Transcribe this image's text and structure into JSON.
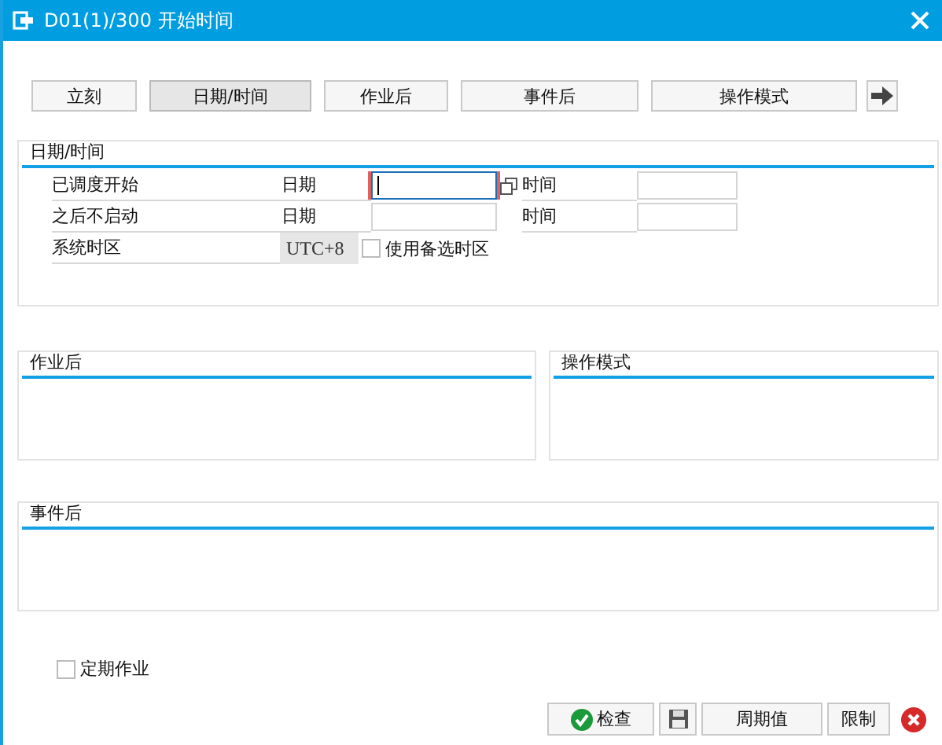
{
  "window": {
    "title": "D01(1)/300 开始时间"
  },
  "tabs": [
    {
      "label": "立刻",
      "selected": false
    },
    {
      "label": "日期/时间",
      "selected": true
    },
    {
      "label": "作业后",
      "selected": false
    },
    {
      "label": "事件后",
      "selected": false
    },
    {
      "label": "操作模式",
      "selected": false
    }
  ],
  "datetime_group": {
    "title": "日期/时间",
    "rows": [
      {
        "label": "已调度开始",
        "date_label": "日期",
        "time_label": "时间",
        "focused": true
      },
      {
        "label": "之后不启动",
        "date_label": "日期",
        "time_label": "时间",
        "focused": false
      }
    ],
    "timezone": {
      "label": "系统时区",
      "value": "UTC+8",
      "alt_label": "使用备选时区",
      "checked": false
    }
  },
  "groups": [
    {
      "title": "作业后"
    },
    {
      "title": "操作模式"
    },
    {
      "title": "事件后"
    }
  ],
  "periodic_job": {
    "label": "定期作业",
    "checked": false
  },
  "footer_buttons": [
    {
      "kind": "check",
      "label": "检查"
    },
    {
      "kind": "save"
    },
    {
      "kind": "text",
      "label": "周期值"
    },
    {
      "kind": "text",
      "label": "限制"
    },
    {
      "kind": "cancel"
    }
  ]
}
